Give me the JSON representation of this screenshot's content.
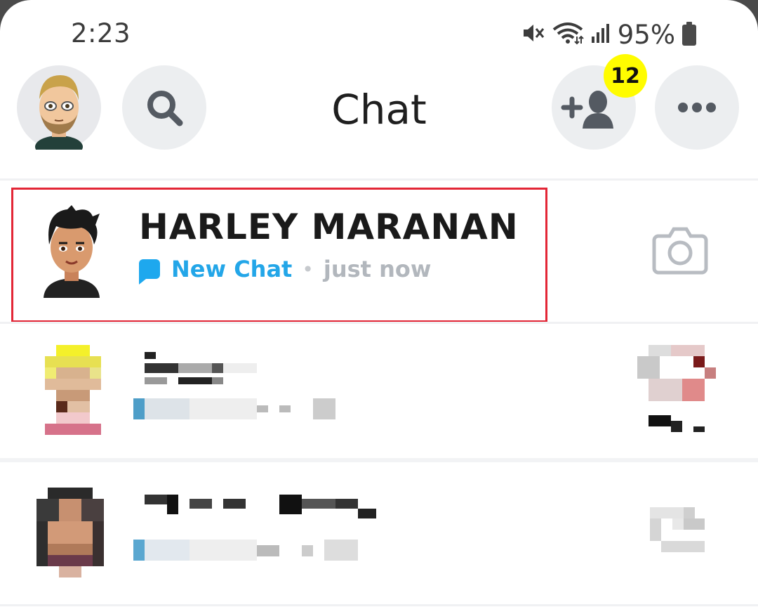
{
  "status_bar": {
    "time": "2:23",
    "battery": "95%",
    "icons": [
      "mute-icon",
      "wifi-icon",
      "signal-icon",
      "battery-icon"
    ]
  },
  "header": {
    "title": "Chat",
    "friend_requests_badge": "12",
    "icons": [
      "avatar",
      "search-icon",
      "add-friend-icon",
      "more-icon"
    ]
  },
  "chats": [
    {
      "name": "HARLEY MARANAN",
      "status": "New Chat",
      "time": "just now",
      "action_icon": "camera-icon",
      "highlighted": true
    },
    {
      "name": "",
      "status": "",
      "time": "",
      "action_icon": "pixelated-icon",
      "highlighted": false
    },
    {
      "name": "",
      "status": "",
      "time": "",
      "action_icon": "pixelated-icon",
      "highlighted": false
    }
  ],
  "colors": {
    "accent_blue": "#23a6e8",
    "badge_yellow": "#fffc00",
    "highlight_red": "#e32636"
  }
}
